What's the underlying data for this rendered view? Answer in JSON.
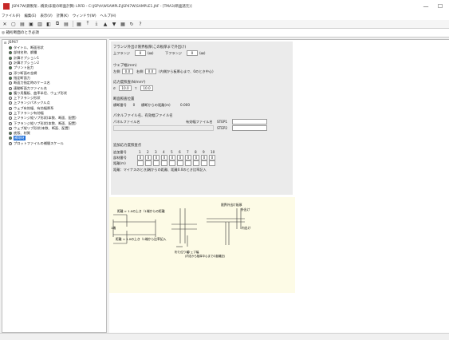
{
  "window": {
    "title": "JSP47W(鋼製架…橋梁/床版の断面計算) LRFD - C:\\JSP\\A\\WSAMPLE\\JSP47W\\SAMPLE1.JAF - [TMA3(断面諸元)]",
    "buttons": [
      "—",
      "☐"
    ]
  },
  "menu": {
    "items": [
      "ファイル(F)",
      "編集(E)",
      "表示(V)",
      "計算(K)",
      "ウィンドウ(W)",
      "ヘルプ(H)"
    ]
  },
  "toolbar": {
    "icons": [
      "close-icon",
      "new-icon",
      "open-icon",
      "save-icon",
      "print-icon",
      "preview-icon",
      "copy-icon",
      "paste-icon",
      "calc-icon",
      "up-icon",
      "down-icon",
      "up-arrow-icon",
      "down-arrow-icon",
      "grid-icon",
      "refresh-icon",
      "help-icon"
    ],
    "glyphs": [
      "✕",
      "▢",
      "▤",
      "▣",
      "▥",
      "◧",
      "⧉",
      "▤",
      "▦",
      "⤒",
      "⤓",
      "▲",
      "▼",
      "▦",
      "↻",
      "?"
    ]
  },
  "header": {
    "text": "◎ 箱桁断面のとき必須"
  },
  "tree": {
    "root": "JSP47",
    "items": [
      {
        "label": "タイトル、断面形状",
        "done": true
      },
      {
        "label": "部材名称、鋼種",
        "done": true
      },
      {
        "label": "計算オプション1",
        "done": true
      },
      {
        "label": "計算オプション2",
        "done": false
      },
      {
        "label": "プリント出力",
        "done": true
      },
      {
        "label": "添り断面の金網",
        "done": false
      },
      {
        "label": "指定断面力",
        "done": true
      },
      {
        "label": "断面力指定時のケース名",
        "done": false
      },
      {
        "label": "連動断面力ファイル名",
        "done": false
      },
      {
        "label": "腹り用腹板、曲率半径、ウェブ形状",
        "done": true
      },
      {
        "label": "上下フランジ形状",
        "done": false
      },
      {
        "label": "上フランジパネックル点",
        "done": false
      },
      {
        "label": "ウェブ有効幅、有効幅厚系",
        "done": false
      },
      {
        "label": "上下フランジ有効幅",
        "done": false
      },
      {
        "label": "上フランジ縦リブ形状(本数、断面、配置)",
        "done": false
      },
      {
        "label": "下フランジ縦リブ形状(本数、断面、配置)",
        "done": false
      },
      {
        "label": "ウェブ縦リブ形状(本数、断面、配置)",
        "done": false
      },
      {
        "label": "底版、材質",
        "done": true
      },
      {
        "label": "補剛材",
        "done": true,
        "selected": true
      },
      {
        "label": "プロットファイルの補間スケール",
        "done": false
      }
    ]
  },
  "form": {
    "flange": {
      "title": "フランジ外出け限界板厚(この板厚まで外出け)",
      "upper_label": "上フランジ",
      "upper_value": "0",
      "lower_label": "下フランジ",
      "lower_value": "0",
      "unit": "(㎜)"
    },
    "web": {
      "title": "ウェブ幅(mm)",
      "left_label": "左側",
      "left_value": "0.0",
      "right_label": "右側",
      "right_value": "0.0",
      "note": "(内側から板厚心まで、0のとき中心)"
    },
    "stress": {
      "title": "応力度照査(N/mm²)",
      "sigma_label": "σ",
      "sigma_value": "10.0",
      "tau_label": "τ",
      "tau_value": "10.0"
    },
    "section": {
      "title": "断面照査位置",
      "label": "横断番号",
      "value": "0",
      "unit_label": "横断からの距離(m)",
      "dist_value": "0.000"
    },
    "panel": {
      "title": "パネルファイル名、有効幅ファイル名",
      "panel_label": "パネルファイル名",
      "eff_label": "有効幅ファイル名",
      "step1": "STEP1",
      "step2": "STEP2"
    },
    "addstress": {
      "title": "追加応力度照査点",
      "row1_label": "追加番号",
      "row2_label": "部材番号",
      "row3_label": "距離(m)",
      "numbers": [
        "1",
        "2",
        "3",
        "4",
        "5",
        "6",
        "7",
        "8",
        "9",
        "10"
      ],
      "zeros": [
        "0",
        "0",
        "0",
        "0",
        "0",
        "0",
        "0",
        "0",
        "0",
        "0"
      ],
      "note": "距離：マイナスのときJ端からの距離、距離0.0のとき比率記入"
    }
  },
  "figure": {
    "lbl1": "距離 > 1.0の上き（1端からの距離",
    "lbl2": "1端",
    "lbl3": "距離 < 1.0の上き（1端から比率記入",
    "lbl4": "桁た位り幅",
    "lbl5": "ウェブ幅",
    "lbl6": "(内法から板厚中心までの距離記)",
    "lbl7": "限界外出け板厚",
    "lbl8": "外出け",
    "lbl9": "内出け"
  }
}
